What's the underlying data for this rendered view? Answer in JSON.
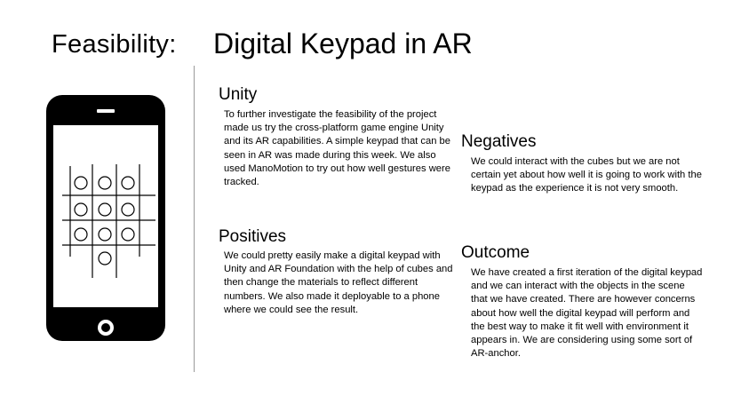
{
  "slide": {
    "label": "Feasibility:",
    "title": "Digital Keypad in AR"
  },
  "sections": {
    "unity": {
      "heading": "Unity",
      "body": "To further investigate the feasibility of the project made us try the cross-platform game engine Unity and its AR capabilities. A simple keypad that can be seen in AR was made during this week. We also used ManoMotion to try out how well gestures were tracked."
    },
    "positives": {
      "heading": "Positives",
      "body": "We could pretty easily make a digital keypad with Unity and AR Foundation with the help of cubes and then change the materials to reflect different numbers. We also made it deployable to a phone where we could see the result."
    },
    "negatives": {
      "heading": "Negatives",
      "body": "We could interact with the cubes but we are not certain yet about how well it is going to work with the keypad as the experience it is not very smooth."
    },
    "outcome": {
      "heading": "Outcome",
      "body": "We have created a first iteration of the digital keypad and we can interact with the objects in the scene that we have created. There are however concerns about how well the digital keypad will perform and the best way to make it fit well with environment it appears in. We are considering using some sort of AR-anchor."
    }
  },
  "illustration": {
    "icon": "smartphone-with-keypad-grid",
    "color": "#000000"
  }
}
